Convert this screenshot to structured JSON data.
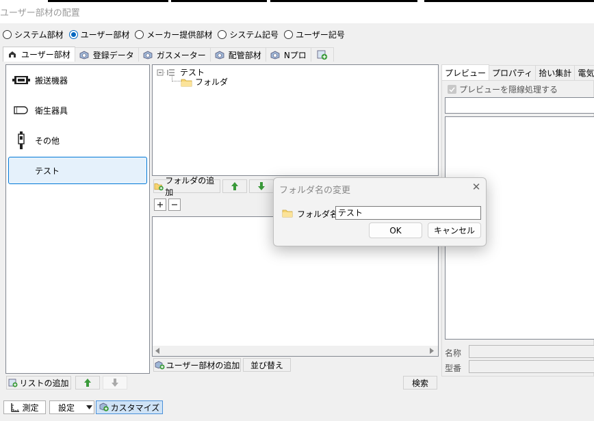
{
  "window": {
    "title": "ユーザー部材の配置"
  },
  "mode_options": [
    {
      "label": "システム部材",
      "selected": false
    },
    {
      "label": "ユーザー部材",
      "selected": true
    },
    {
      "label": "メーカー提供部材",
      "selected": false
    },
    {
      "label": "システム記号",
      "selected": false
    },
    {
      "label": "ユーザー記号",
      "selected": false
    }
  ],
  "tabs": [
    "ユーザー部材",
    "登録データ",
    "ガスメーター",
    "配管部材",
    "Nプロ"
  ],
  "categories": [
    {
      "label": "搬送機器",
      "icon": "conveyor-icon"
    },
    {
      "label": "衛生器具",
      "icon": "sanitary-icon"
    },
    {
      "label": "その他",
      "icon": "other-icon"
    },
    {
      "label": "テスト",
      "icon": "none"
    }
  ],
  "left_buttons": {
    "add_list": "リストの追加",
    "search": "検索"
  },
  "tree": {
    "root": "テスト",
    "child": "フォルダ"
  },
  "tree_buttons": {
    "add_folder": "フォルダの追加"
  },
  "list_buttons": {
    "add_user_part": "ユーザー部材の追加",
    "sort": "並び替え"
  },
  "right_tabs": [
    "プレビュー",
    "プロパティ",
    "拾い集計",
    "電気属性"
  ],
  "preview": {
    "checkbox_label": "プレビューを隠線処理する",
    "checked": true
  },
  "right_fields": {
    "name_label": "名称",
    "model_label": "型番"
  },
  "bottom": {
    "measure": "測定",
    "settings": "設定",
    "customize": "カスタマイズ"
  },
  "dialog": {
    "title": "フォルダ名の変更",
    "field_label": "フォルダ名",
    "field_value": "テスト",
    "ok": "OK",
    "cancel": "キャンセル"
  },
  "colors": {
    "accent": "#0067c0",
    "selection_bg": "#e5f1fb",
    "selection_border": "#0078d7",
    "arrow_green": "#3a9a3a"
  }
}
